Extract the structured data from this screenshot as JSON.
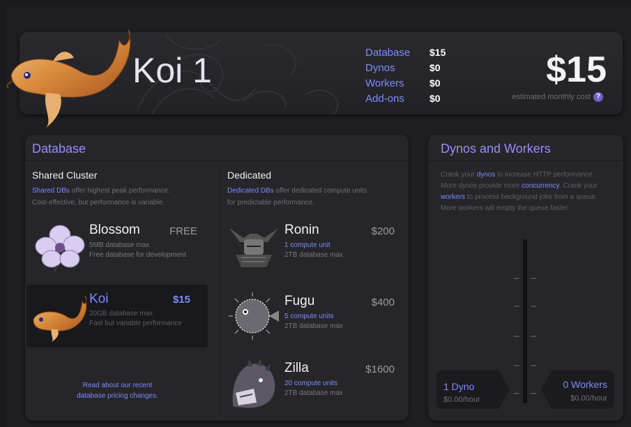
{
  "header": {
    "plan_name": "Koi 1",
    "costs": [
      {
        "label": "Database",
        "value": "$15"
      },
      {
        "label": "Dynos",
        "value": "$0"
      },
      {
        "label": "Workers",
        "value": "$0"
      },
      {
        "label": "Add-ons",
        "value": "$0"
      }
    ],
    "total": "$15",
    "total_note": "estimated monthly cost",
    "help_glyph": "?"
  },
  "database": {
    "title": "Database",
    "shared": {
      "heading": "Shared Cluster",
      "desc_link": "Shared DBs",
      "desc_rest": " offer highest peak performance.",
      "desc_line2": "Cost-effective, but performance is variable.",
      "plans": [
        {
          "name": "Blossom",
          "price": "FREE",
          "line1": "5MB database max",
          "line2": "Free database for development",
          "icon": "cherry-blossom-icon"
        },
        {
          "name": "Koi",
          "price": "$15",
          "line1": "20GB database max",
          "line2": "Fast but variable performance",
          "icon": "koi-fish-icon"
        }
      ],
      "footer_line1": "Read about our recent",
      "footer_line2": "database pricing changes."
    },
    "dedicated": {
      "heading": "Dedicated",
      "desc_link": "Dedicated DBs",
      "desc_rest": " offer dedicated compute units",
      "desc_line2": "for predictable performance.",
      "plans": [
        {
          "name": "Ronin",
          "price": "$200",
          "units": "1 compute unit",
          "storage": "2TB database max",
          "icon": "samurai-helmet-icon"
        },
        {
          "name": "Fugu",
          "price": "$400",
          "units": "5 compute units",
          "storage": "2TB database max",
          "icon": "pufferfish-icon"
        },
        {
          "name": "Zilla",
          "price": "$1600",
          "units": "20 compute units",
          "storage": "2TB database max",
          "icon": "monster-icon"
        }
      ]
    }
  },
  "dynos_workers": {
    "title": "Dynos and Workers",
    "p1": "Crank your ",
    "p1_link": "dynos",
    "p2": " to increase HTTP performance.",
    "p3": "More dynos provide more ",
    "p3_link": "concurrency",
    "p4": ". Crank your",
    "p5_link": "workers",
    "p6": " to process background jobs from a queue.",
    "p7": "More workers will empty the queue faster.",
    "dynos": {
      "count": "1 Dyno",
      "rate": "$0.00/hour"
    },
    "workers": {
      "count": "0 Workers",
      "rate": "$0.00/hour"
    }
  },
  "colors": {
    "accent": "#7c8bff",
    "title": "#9a8cff",
    "background": "#1b1b1e"
  }
}
